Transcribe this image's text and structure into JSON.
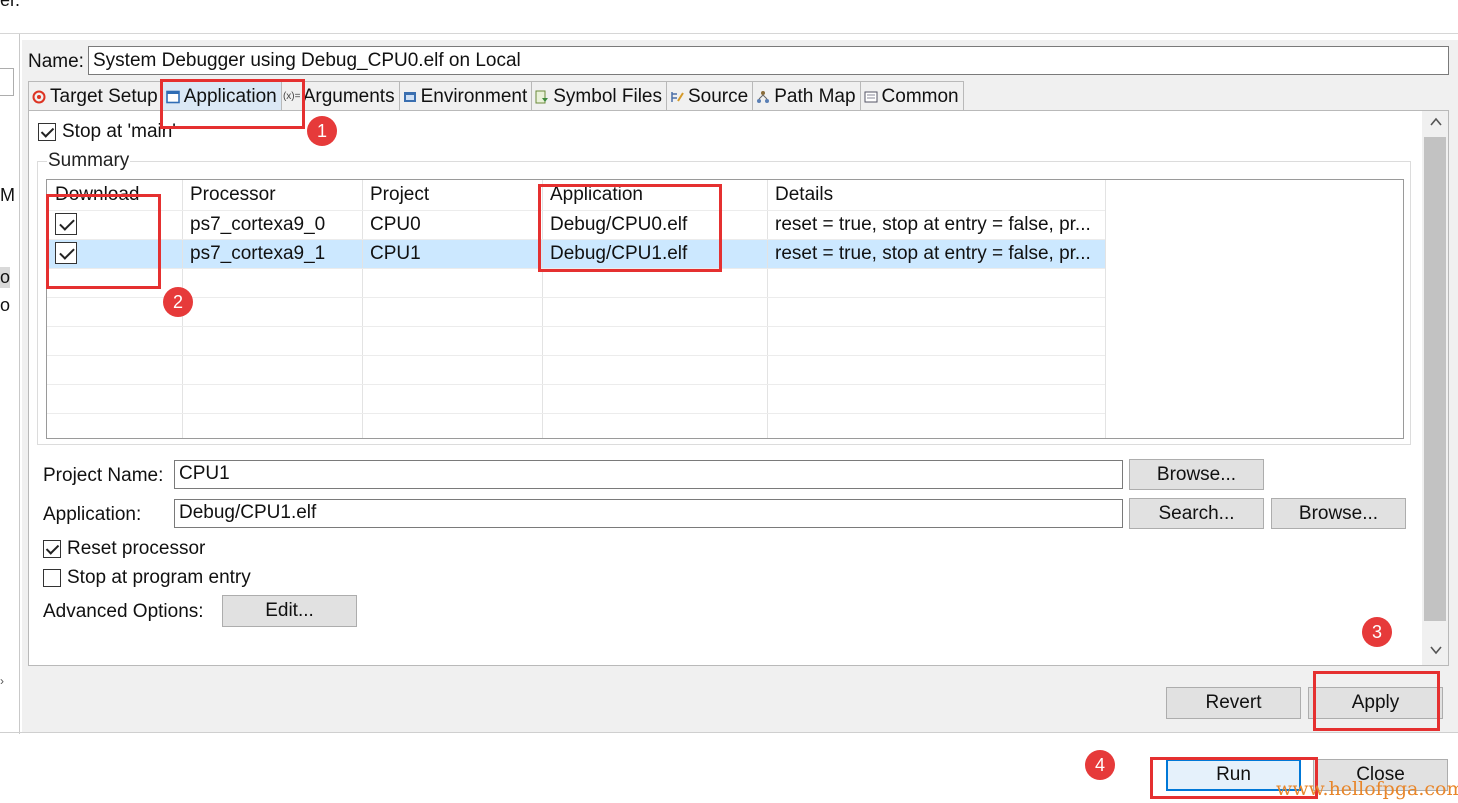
{
  "top": {
    "cut_text": "er."
  },
  "left_fragments": [
    "M",
    "ol",
    "ol"
  ],
  "name": {
    "label": "Name:",
    "value": "System Debugger using Debug_CPU0.elf on Local"
  },
  "tabs": [
    {
      "label": "Target Setup",
      "icon": "target-icon"
    },
    {
      "label": "Application",
      "icon": "window-icon"
    },
    {
      "label": "Arguments",
      "icon": "variable-icon"
    },
    {
      "label": "Environment",
      "icon": "environment-icon"
    },
    {
      "label": "Symbol Files",
      "icon": "symbol-files-icon"
    },
    {
      "label": "Source",
      "icon": "source-icon"
    },
    {
      "label": "Path Map",
      "icon": "path-map-icon"
    },
    {
      "label": "Common",
      "icon": "common-icon"
    }
  ],
  "application_tab": {
    "stop_at_main": {
      "label": "Stop at 'main'",
      "checked": true
    },
    "summary": {
      "label": "Summary",
      "columns": [
        "Download",
        "Processor",
        "Project",
        "Application",
        "Details"
      ],
      "rows": [
        {
          "download": true,
          "processor": "ps7_cortexa9_0",
          "project": "CPU0",
          "application": "Debug/CPU0.elf",
          "details": "reset = true, stop at entry = false, pr..."
        },
        {
          "download": true,
          "processor": "ps7_cortexa9_1",
          "project": "CPU1",
          "application": "Debug/CPU1.elf",
          "details": "reset = true, stop at entry = false, pr...",
          "selected": true
        }
      ]
    },
    "project_name": {
      "label": "Project Name:",
      "value": "CPU1",
      "browse_label": "Browse..."
    },
    "application": {
      "label": "Application:",
      "value": "Debug/CPU1.elf",
      "search_label": "Search...",
      "browse_label": "Browse..."
    },
    "reset_processor": {
      "label": "Reset processor",
      "checked": true
    },
    "stop_at_entry": {
      "label": "Stop at program entry",
      "checked": false
    },
    "advanced": {
      "label": "Advanced Options:",
      "edit_label": "Edit..."
    }
  },
  "buttons": {
    "revert": "Revert",
    "apply": "Apply",
    "run": "Run",
    "close": "Close"
  },
  "annotations": [
    "1",
    "2",
    "3",
    "4"
  ],
  "watermark": "www.hellofpga.com",
  "colors": {
    "highlight_red": "#e53030",
    "selected_row": "#cce8ff",
    "active_tab": "#dbe8f5",
    "watermark": "#e8862a"
  }
}
